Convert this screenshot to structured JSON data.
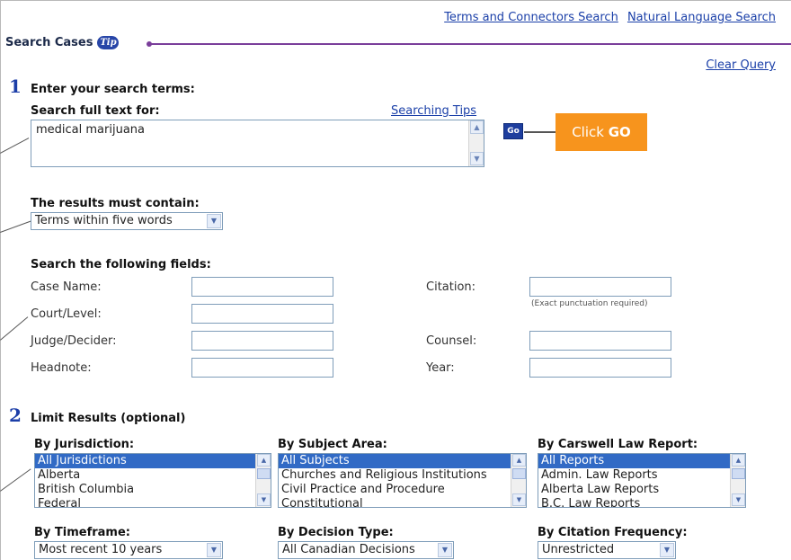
{
  "header": {
    "links": [
      "Terms and Connectors Search",
      "Natural Language Search"
    ],
    "section_title": "Search Cases",
    "tip_icon": "Tip",
    "clear_query": "Clear Query"
  },
  "step1": {
    "number": "1",
    "heading": "Enter your search terms:",
    "search_label": "Search full text for:",
    "searching_tips": "Searching Tips",
    "query_value": "medical marijuana",
    "go_label": "Go",
    "callout": {
      "prefix": "Click ",
      "bold": "GO"
    }
  },
  "results": {
    "heading": "The results must contain:",
    "selected": "Terms within five words"
  },
  "fields": {
    "heading": "Search the following fields:",
    "case_name": "Case Name:",
    "court_level": "Court/Level:",
    "judge": "Judge/Decider:",
    "headnote": "Headnote:",
    "citation": "Citation:",
    "citation_hint": "(Exact punctuation required)",
    "counsel": "Counsel:",
    "year": "Year:"
  },
  "step2": {
    "number": "2",
    "heading": "Limit Results (optional)",
    "jurisdiction": {
      "label": "By Jurisdiction:",
      "options": [
        "All Jurisdictions",
        "Alberta",
        "British Columbia",
        "Federal"
      ]
    },
    "subject": {
      "label": "By Subject Area:",
      "options": [
        "All Subjects",
        "Churches and Religious Institutions",
        "Civil Practice and Procedure",
        "Constitutional"
      ]
    },
    "report": {
      "label": "By Carswell Law Report:",
      "options": [
        "All Reports",
        "Admin. Law Reports",
        "Alberta Law Reports",
        "B.C. Law Reports"
      ]
    },
    "timeframe": {
      "label": "By Timeframe:",
      "selected": "Most recent 10 years"
    },
    "decision_type": {
      "label": "By Decision Type:",
      "selected": "All Canadian Decisions"
    },
    "citation_frequency": {
      "label": "By Citation Frequency:",
      "selected": "Unrestricted"
    }
  },
  "colors": {
    "link": "#1a3fa8",
    "accent_purple": "#7a3e9a",
    "callout_orange": "#f7941d",
    "selection_blue": "#316ac5"
  }
}
